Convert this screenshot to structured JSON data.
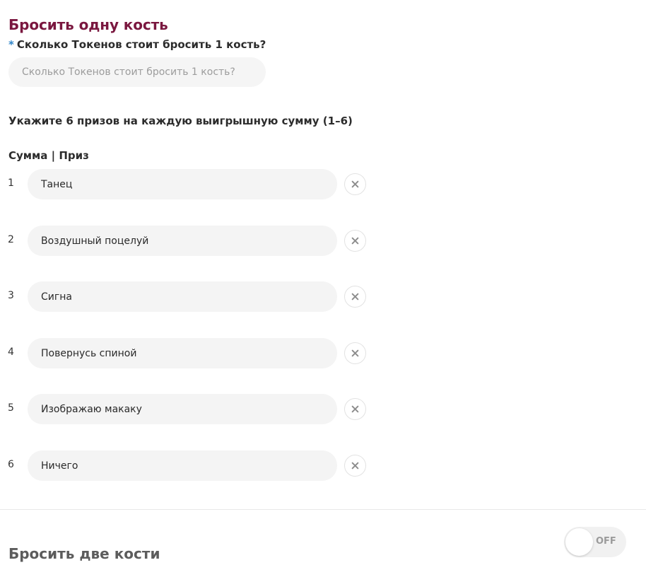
{
  "one_die": {
    "title": "Бросить одну кость",
    "token_cost": {
      "required_mark": "*",
      "label": "Сколько Токенов стоит бросить 1 кость?",
      "placeholder": "Сколько Токенов стоит бросить 1 кость?",
      "value": ""
    },
    "instructions": "Укажите 6 призов на каждую выигрышную сумму (1–6)",
    "table_header": "Сумма | Приз",
    "prizes": [
      {
        "number": "1",
        "value": "Танец"
      },
      {
        "number": "2",
        "value": "Воздушный поцелуй"
      },
      {
        "number": "3",
        "value": "Сигна"
      },
      {
        "number": "4",
        "value": "Повернусь спиной"
      },
      {
        "number": "5",
        "value": "Изображаю макаку"
      },
      {
        "number": "6",
        "value": "Ничего"
      }
    ],
    "remove_icon": "close-icon"
  },
  "two_dice": {
    "title": "Бросить две кости",
    "toggle_state": "OFF"
  },
  "colors": {
    "title": "#7a173f",
    "required_mark": "#2f84c8",
    "input_background": "#f4f4f4",
    "muted_text": "#9b9b9b"
  }
}
